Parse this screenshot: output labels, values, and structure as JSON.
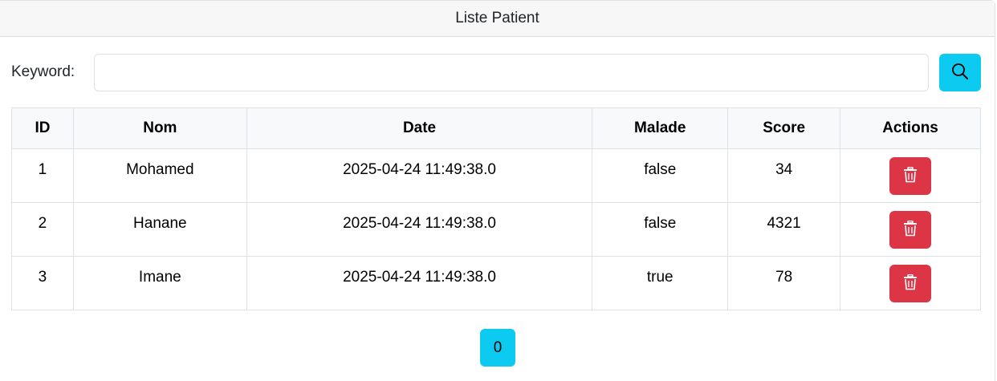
{
  "card": {
    "title": "Liste Patient"
  },
  "search": {
    "label": "Keyword:",
    "value": "",
    "button_icon": "search-icon"
  },
  "table": {
    "columns": [
      "ID",
      "Nom",
      "Date",
      "Malade",
      "Score",
      "Actions"
    ],
    "rows": [
      {
        "id": "1",
        "nom": "Mohamed",
        "date": "2025-04-24 11:49:38.0",
        "malade": "false",
        "score": "34",
        "action_icon": "trash-icon"
      },
      {
        "id": "2",
        "nom": "Hanane",
        "date": "2025-04-24 11:49:38.0",
        "malade": "false",
        "score": "4321",
        "action_icon": "trash-icon"
      },
      {
        "id": "3",
        "nom": "Imane",
        "date": "2025-04-24 11:49:38.0",
        "malade": "true",
        "score": "78",
        "action_icon": "trash-icon"
      }
    ]
  },
  "pagination": {
    "pages": [
      "0"
    ]
  },
  "colors": {
    "info": "#0dcaf0",
    "danger": "#dc3545",
    "header_bg": "#f7f7f7",
    "table_head_bg": "#f8f9fa",
    "border": "#dee2e6"
  }
}
